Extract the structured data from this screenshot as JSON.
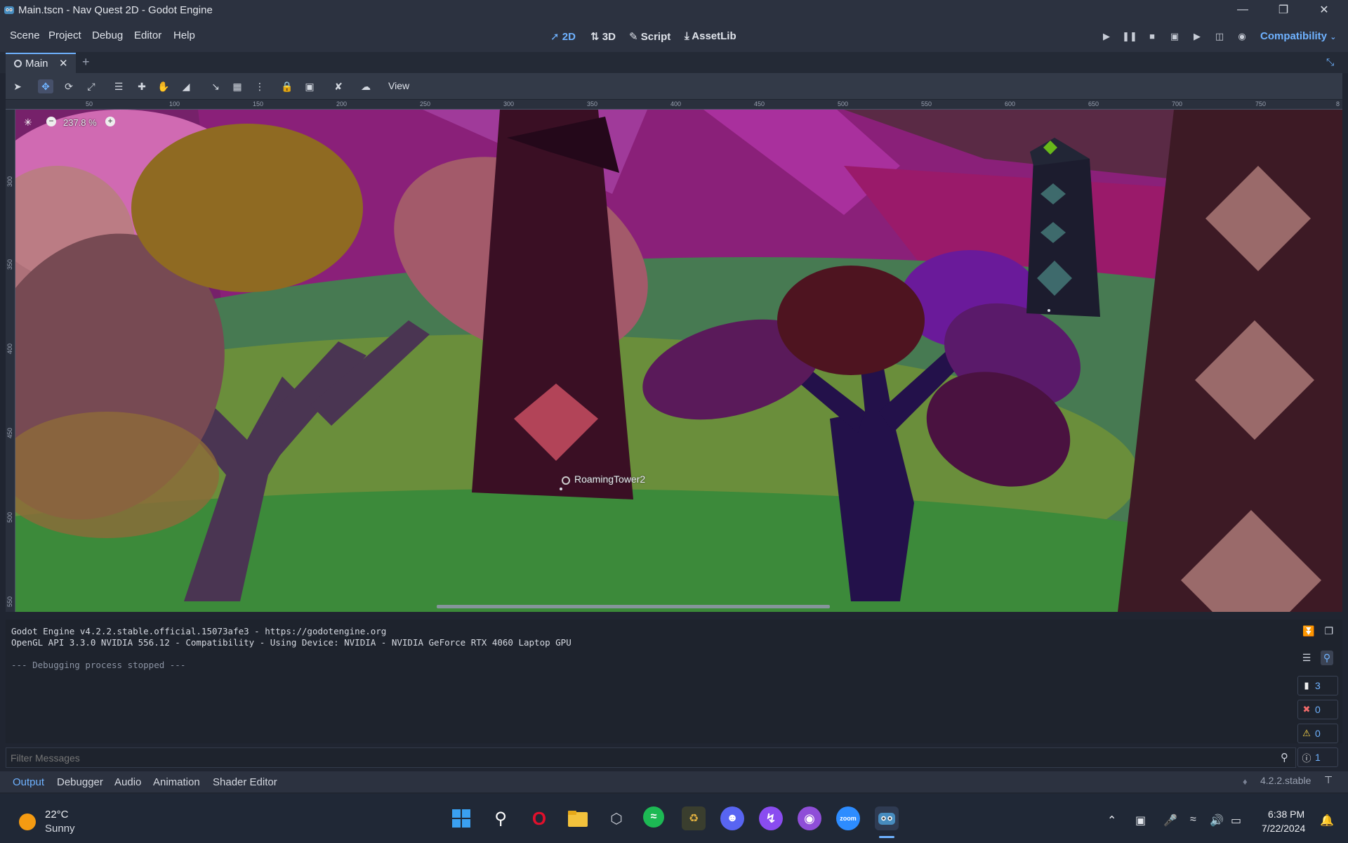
{
  "window": {
    "title": "Main.tscn - Nav Quest 2D - Godot Engine",
    "controls": [
      "minimize-icon",
      "restore-icon",
      "close-icon"
    ]
  },
  "menu": {
    "items": [
      "Scene",
      "Project",
      "Debug",
      "Editor",
      "Help"
    ]
  },
  "workspaces": [
    {
      "label": "2D",
      "icon": "2d-arrows-icon",
      "active": true
    },
    {
      "label": "3D",
      "icon": "3d-arrows-icon",
      "active": false
    },
    {
      "label": "Script",
      "icon": "script-icon",
      "active": false
    },
    {
      "label": "AssetLib",
      "icon": "download-icon",
      "active": false
    }
  ],
  "renderer": "Compatibility",
  "scene_tabs": [
    {
      "label": "Main"
    }
  ],
  "toolbar": {
    "view_label": "View"
  },
  "viewport": {
    "zoom": "237.8 %",
    "node_label": "RoamingTower2",
    "ruler_top": [
      "50",
      "100",
      "150",
      "200",
      "250",
      "300",
      "350",
      "400",
      "450",
      "500",
      "550",
      "600",
      "650",
      "700",
      "750",
      "8"
    ],
    "ruler_left": [
      "300",
      "350",
      "400",
      "450",
      "500",
      "550"
    ]
  },
  "output": {
    "lines": [
      "Godot Engine v4.2.2.stable.official.15073afe3 - https://godotengine.org",
      "OpenGL API 3.3.0 NVIDIA 556.12 - Compatibility - Using Device: NVIDIA - NVIDIA GeForce RTX 4060 Laptop GPU",
      "",
      "--- Debugging process stopped ---"
    ],
    "filter_placeholder": "Filter Messages",
    "counts": {
      "messages": "3",
      "errors": "0",
      "warnings": "0",
      "info": "1"
    }
  },
  "bottom_tabs": [
    "Output",
    "Debugger",
    "Audio",
    "Animation",
    "Shader Editor"
  ],
  "version": "4.2.2.stable",
  "taskbar": {
    "weather_temp": "22°C",
    "weather_desc": "Sunny",
    "time": "6:38 PM",
    "date": "7/22/2024"
  },
  "colors": {
    "accent": "#6fb2ff",
    "error": "#f26b6b",
    "warning": "#ffd84a"
  }
}
